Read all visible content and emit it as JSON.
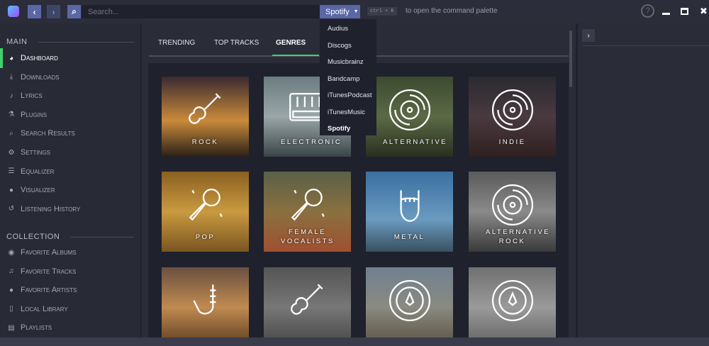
{
  "top": {
    "search_placeholder": "Search...",
    "provider": "Spotify",
    "kbd": "ctrl + K",
    "hint": "to open the command palette"
  },
  "providers": [
    "Audius",
    "Discogs",
    "Musicbrainz",
    "Bandcamp",
    "iTunesPodcast",
    "iTunesMusic",
    "Spotify"
  ],
  "sidebar": {
    "main_header": "MAIN",
    "main_items": [
      {
        "label": "Dashboard",
        "icon": "dashboard-icon",
        "glyph": "◕"
      },
      {
        "label": "Downloads",
        "icon": "download-icon",
        "glyph": "⤓"
      },
      {
        "label": "Lyrics",
        "icon": "microphone-icon",
        "glyph": "♪"
      },
      {
        "label": "Plugins",
        "icon": "flask-icon",
        "glyph": "⚗"
      },
      {
        "label": "Search Results",
        "icon": "search-icon",
        "glyph": "⌕"
      },
      {
        "label": "Settings",
        "icon": "gear-icon",
        "glyph": "⚙"
      },
      {
        "label": "Equalizer",
        "icon": "sliders-icon",
        "glyph": "☰"
      },
      {
        "label": "Visualizer",
        "icon": "drop-icon",
        "glyph": "●"
      },
      {
        "label": "Listening History",
        "icon": "history-icon",
        "glyph": "↺"
      }
    ],
    "collection_header": "COLLECTION",
    "collection_items": [
      {
        "label": "Favorite Albums",
        "icon": "disc-icon",
        "glyph": "◉"
      },
      {
        "label": "Favorite Tracks",
        "icon": "music-note-icon",
        "glyph": "♫"
      },
      {
        "label": "Favorite Artists",
        "icon": "user-icon",
        "glyph": "●"
      },
      {
        "label": "Local Library",
        "icon": "file-icon",
        "glyph": "▯"
      },
      {
        "label": "Playlists",
        "icon": "list-icon",
        "glyph": "▤"
      }
    ]
  },
  "tabs": [
    "TRENDING",
    "TOP TRACKS",
    "GENRES"
  ],
  "genres": [
    {
      "name": "ROCK",
      "icon": "guitar",
      "bg": "linear-gradient(180deg,#3a2a30,#c98a3a 55%,#2a2018)"
    },
    {
      "name": "ELECTRONIC",
      "icon": "mixer",
      "bg": "linear-gradient(180deg,#6b7c80,#9aa6a8 50%,#3a4548)"
    },
    {
      "name": "ALTERNATIVE",
      "icon": "disc",
      "bg": "linear-gradient(180deg,#3c4a30,#5b6a45 50%,#2a3020)"
    },
    {
      "name": "INDIE",
      "icon": "disc",
      "bg": "linear-gradient(180deg,#2a2a30,#4a3a40 50%,#302020)"
    },
    {
      "name": "POP",
      "icon": "mic",
      "bg": "linear-gradient(180deg,#8a6020,#c99a40 50%,#7a5520)"
    },
    {
      "name": "FEMALE VOCALISTS",
      "icon": "mic",
      "bg": "linear-gradient(180deg,#5a6048,#8a7040 50%,#a05030)"
    },
    {
      "name": "METAL",
      "icon": "hand",
      "bg": "linear-gradient(180deg,#3a70a0,#6a9ac0 60%,#3a5060)"
    },
    {
      "name": "ALTERNATIVE ROCK",
      "icon": "disc",
      "bg": "linear-gradient(180deg,#5a5a5a,#8a8a8a 50%,#3a3a3a)"
    },
    {
      "name": "",
      "icon": "sax",
      "bg": "linear-gradient(180deg,#6a5040,#c08a50 50%,#5a3a20)"
    },
    {
      "name": "",
      "icon": "guitar",
      "bg": "linear-gradient(180deg,#555,#777 50%,#444)"
    },
    {
      "name": "",
      "icon": "compass",
      "bg": "linear-gradient(180deg,#708090,#8a8a80 50%,#5a5040)"
    },
    {
      "name": "",
      "icon": "compass",
      "bg": "linear-gradient(180deg,#707070,#9a9a9a 50%,#606060)"
    }
  ],
  "colors": {
    "accent": "#3ed16c",
    "button": "#5a67a6"
  }
}
